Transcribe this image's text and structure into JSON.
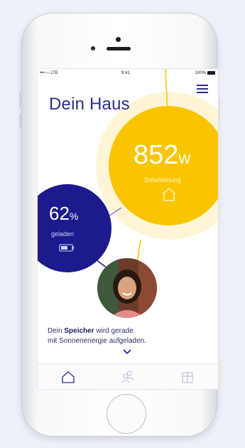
{
  "status_bar": {
    "carrier": "•••○○ LTE",
    "time": "9:41",
    "battery": "100%"
  },
  "header": {
    "title": "Dein Haus"
  },
  "solar": {
    "value": "852",
    "unit": "W",
    "label": "Solarleistung",
    "color": "#f8c500"
  },
  "battery": {
    "value": "62",
    "unit": "%",
    "label": "geladen",
    "color": "#1c1a8c"
  },
  "message": {
    "prefix": "Dein ",
    "highlight": "Speicher",
    "rest": " wird gerade",
    "line2": "mit Sonnenenergie aufgeladen."
  },
  "tabs": [
    {
      "icon": "home-icon"
    },
    {
      "icon": "people-icon"
    },
    {
      "icon": "box-icon"
    }
  ]
}
